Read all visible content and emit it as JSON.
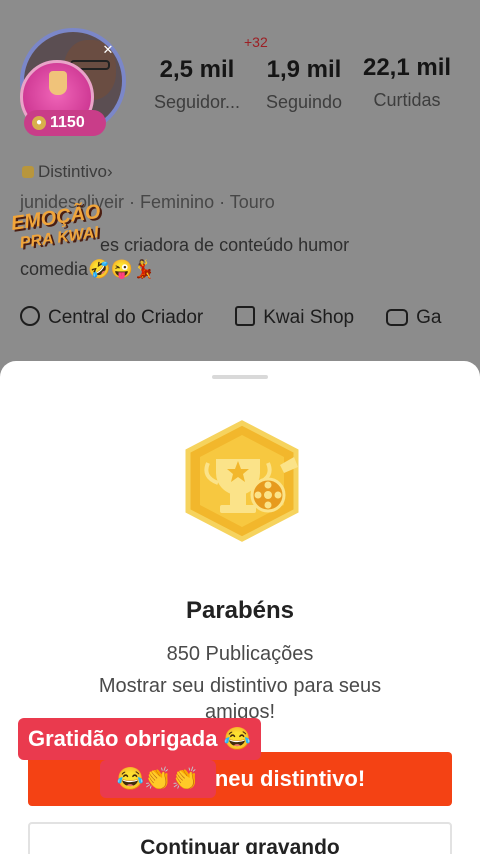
{
  "profile": {
    "avatar_count": "1150",
    "new_followers_badge": "+32",
    "stats": [
      {
        "value": "2,5 mil",
        "label": "Seguidor..."
      },
      {
        "value": "1,9 mil",
        "label": "Seguindo"
      },
      {
        "value": "22,1 mil",
        "label": "Curtidas"
      }
    ],
    "distintivo_label": "Distintivo",
    "distintivo_chevron": "›",
    "meta": "junidesoliveir · Feminino · Touro",
    "bio_line1": "es criadora de conteúdo humor",
    "bio_line2": "comedia🤣😜💃",
    "sticker_line1": "EMOÇÃO",
    "sticker_line2": "PRA KWAI",
    "quick_links": [
      {
        "label": "Central do Criador",
        "icon": "bolt-circle-icon"
      },
      {
        "label": "Kwai Shop",
        "icon": "shopping-bag-icon"
      },
      {
        "label": "Ga",
        "icon": "gamepad-icon"
      }
    ]
  },
  "sheet": {
    "title": "Parabéns",
    "count": "850 Publicações",
    "description": "Mostrar seu distintivo para seus amigos!",
    "primary_label": "neu distintivo!",
    "secondary_label": "Continuar gravando"
  },
  "captions": {
    "line1": "Gratidão obrigada 😂",
    "line2": "😂👏👏"
  },
  "colors": {
    "accent": "#f44214",
    "caption_bg": "#ea3a4e",
    "medal_gold": "#f2b72c"
  }
}
